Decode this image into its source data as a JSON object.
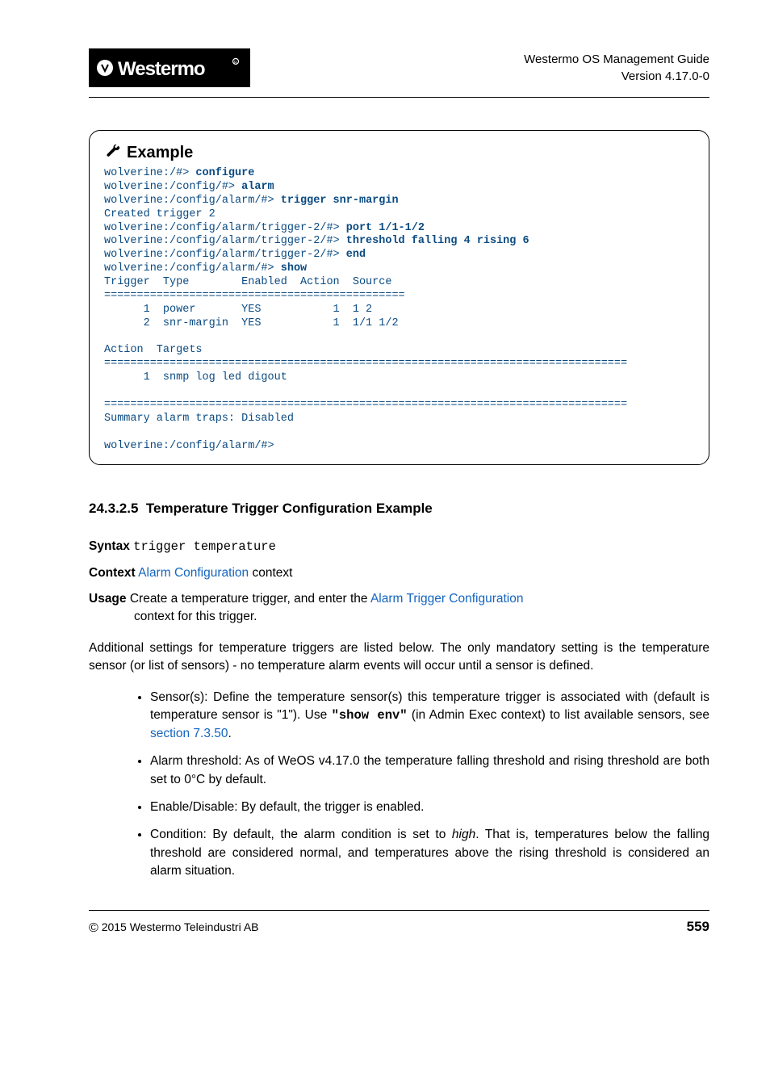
{
  "header": {
    "guide_title": "Westermo OS Management Guide",
    "version_line": "Version 4.17.0-0"
  },
  "example": {
    "title": "Example",
    "lines": [
      {
        "prompt": "wolverine:/#> ",
        "cmd": "configure"
      },
      {
        "prompt": "wolverine:/config/#> ",
        "cmd": "alarm"
      },
      {
        "prompt": "wolverine:/config/alarm/#> ",
        "cmd": "trigger snr-margin"
      },
      {
        "text": "Created trigger 2"
      },
      {
        "prompt": "wolverine:/config/alarm/trigger-2/#> ",
        "cmd": "port 1/1-1/2"
      },
      {
        "prompt": "wolverine:/config/alarm/trigger-2/#> ",
        "cmd": "threshold falling 4 rising 6"
      },
      {
        "prompt": "wolverine:/config/alarm/trigger-2/#> ",
        "cmd": "end"
      },
      {
        "prompt": "wolverine:/config/alarm/#> ",
        "cmd": "show"
      },
      {
        "text": "Trigger  Type        Enabled  Action  Source"
      },
      {
        "text": "=============================================="
      },
      {
        "text": "      1  power       YES           1  1 2"
      },
      {
        "text": "      2  snr-margin  YES           1  1/1 1/2"
      },
      {
        "text": ""
      },
      {
        "text": "Action  Targets"
      },
      {
        "text": "================================================================================"
      },
      {
        "text": "      1  snmp log led digout"
      },
      {
        "text": ""
      },
      {
        "text": "================================================================================"
      },
      {
        "text": "Summary alarm traps: Disabled"
      },
      {
        "text": ""
      },
      {
        "text": "wolverine:/config/alarm/#>"
      }
    ]
  },
  "section": {
    "number": "24.3.2.5",
    "title": "Temperature Trigger Configuration Example"
  },
  "syntax": {
    "label": "Syntax",
    "value": "trigger temperature"
  },
  "context": {
    "label": "Context",
    "link_text": "Alarm Configuration",
    "suffix": " context"
  },
  "usage": {
    "label": "Usage",
    "lead_pre": " Create a temperature trigger, and enter the ",
    "lead_link": "Alarm Trigger Configuration",
    "lead_post": " context for this trigger.",
    "para2": "Additional settings for temperature triggers are listed below. The only mandatory setting is the temperature sensor (or list of sensors) - no temperature alarm events will occur until a sensor is defined.",
    "bullets": {
      "b1_pre": "Sensor(s): Define the temperature sensor(s) this temperature trigger is associated with (default is temperature sensor is \"1\"). Use ",
      "b1_code": "\"show env\"",
      "b1_mid": " (in Admin Exec context) to list available sensors, see ",
      "b1_link": "section 7.3.50",
      "b1_end": ".",
      "b2": "Alarm threshold: As of WeOS v4.17.0 the temperature falling threshold and rising threshold are both set to 0°C by default.",
      "b3": "Enable/Disable: By default, the trigger is enabled.",
      "b4_pre": "Condition: By default, the alarm condition is set to ",
      "b4_em": "high",
      "b4_post": ". That is, temperatures below the falling threshold are considered normal, and temperatures above the rising threshold is considered an alarm situation."
    }
  },
  "footer": {
    "copyright": "2015 Westermo Teleindustri AB",
    "page": "559"
  }
}
